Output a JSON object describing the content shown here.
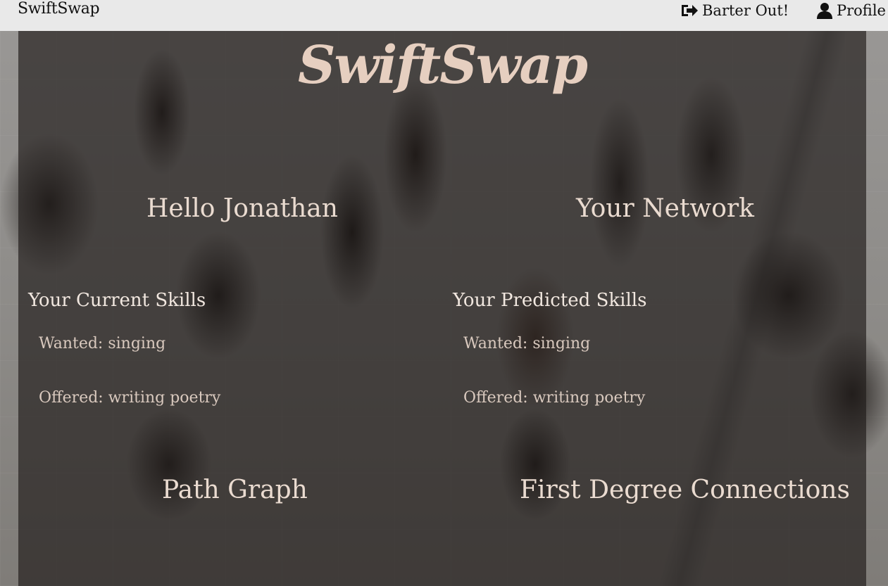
{
  "navbar": {
    "brand": "SwiftSwap",
    "barter_out_label": "Barter Out!",
    "profile_label": "Profile",
    "barter_icon": "sign-out-icon",
    "profile_icon": "user-icon"
  },
  "hero": {
    "title": "SwiftSwap"
  },
  "greeting": "Hello Jonathan",
  "network_heading": "Your Network",
  "current_skills": {
    "heading": "Your Current Skills",
    "wanted_label": "Wanted:",
    "wanted_value": "singing",
    "offered_label": "Offered:",
    "offered_value": "writing poetry"
  },
  "predicted_skills": {
    "heading": "Your Predicted Skills",
    "wanted_label": "Wanted:",
    "wanted_value": "singing",
    "offered_label": "Offered:",
    "offered_value": "writing poetry"
  },
  "path_graph_heading": "Path Graph",
  "first_degree_heading": "First Degree Connections",
  "colors": {
    "navbar_bg": "#e9e9e9",
    "hero_title": "#e6cfc0",
    "heading_text": "#eadbd0",
    "body_text": "#d9c9be"
  }
}
